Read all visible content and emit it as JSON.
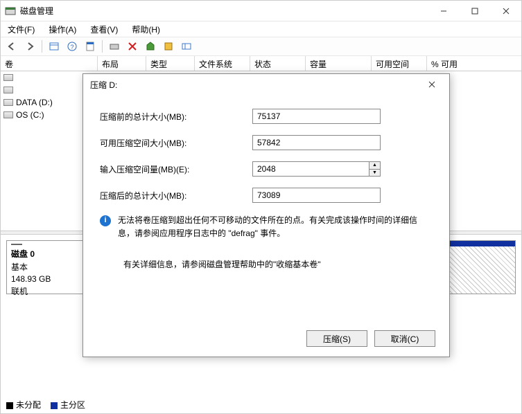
{
  "window": {
    "title": "磁盘管理",
    "controls": {
      "min": "—",
      "max": "□",
      "close": "✕"
    }
  },
  "menu": {
    "file": "文件(F)",
    "action": "操作(A)",
    "view": "查看(V)",
    "help": "帮助(H)"
  },
  "columns": {
    "volume": "卷",
    "layout": "布局",
    "type": "类型",
    "filesystem": "文件系统",
    "status": "状态",
    "capacity": "容量",
    "freespace": "可用空间",
    "pctfree": "% 可用"
  },
  "volumes": [
    {
      "name": ""
    },
    {
      "name": ""
    },
    {
      "name": "DATA (D:)"
    },
    {
      "name": "OS (C:)"
    }
  ],
  "disk": {
    "title": "磁盘 0",
    "type": "基本",
    "size": "148.93 GB",
    "status": "联机"
  },
  "legend": {
    "unallocated": "未分配",
    "primary": "主分区"
  },
  "dialog": {
    "title": "压缩 D:",
    "labels": {
      "before": "压缩前的总计大小(MB):",
      "avail": "可用压缩空间大小(MB):",
      "amount": "输入压缩空间量(MB)(E):",
      "after": "压缩后的总计大小(MB):"
    },
    "values": {
      "before": "75137",
      "avail": "57842",
      "amount": "2048",
      "after": "73089"
    },
    "info": "无法将卷压缩到超出任何不可移动的文件所在的点。有关完成该操作时间的详细信息，请参阅应用程序日志中的 \"defrag\" 事件。",
    "ref": "有关详细信息，请参阅磁盘管理帮助中的\"收缩基本卷\"",
    "buttons": {
      "shrink": "压缩(S)",
      "cancel": "取消(C)"
    }
  }
}
